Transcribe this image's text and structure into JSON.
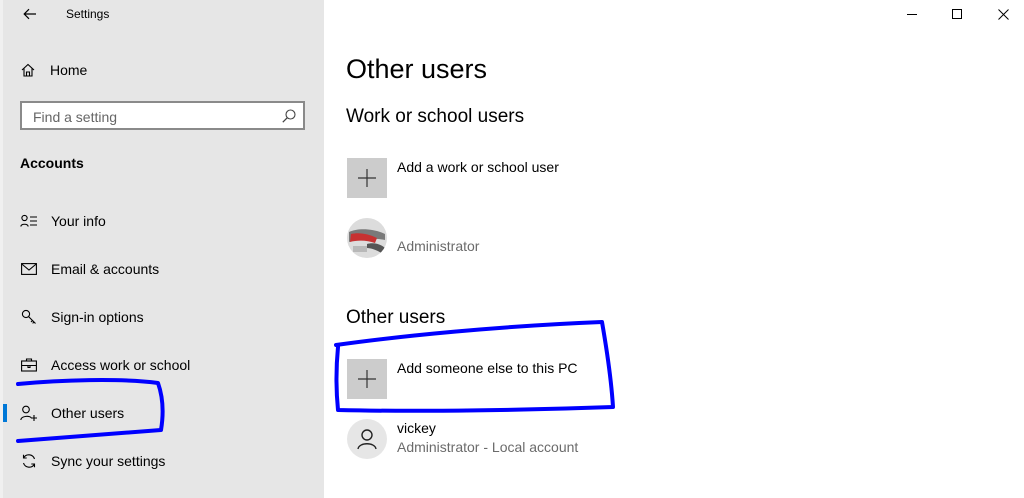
{
  "window": {
    "title": "Settings",
    "controls": [
      "minimize",
      "maximize",
      "close"
    ]
  },
  "sidebar": {
    "home_label": "Home",
    "search": {
      "placeholder": "Find a setting"
    },
    "section_label": "Accounts",
    "items": [
      {
        "label": "Your info",
        "icon": "person-list-icon"
      },
      {
        "label": "Email & accounts",
        "icon": "mail-icon"
      },
      {
        "label": "Sign-in options",
        "icon": "key-icon"
      },
      {
        "label": "Access work or school",
        "icon": "briefcase-icon"
      },
      {
        "label": "Other users",
        "icon": "person-add-icon",
        "selected": true
      },
      {
        "label": "Sync your settings",
        "icon": "sync-icon"
      }
    ]
  },
  "main": {
    "page_title": "Other users",
    "work_section": {
      "title": "Work or school users",
      "add_label": "Add a work or school user",
      "user": {
        "name": "",
        "role": "Administrator"
      }
    },
    "other_section": {
      "title": "Other users",
      "add_label": "Add someone else to this PC",
      "user": {
        "name": "vickey",
        "role": "Administrator - Local account"
      }
    }
  },
  "colors": {
    "sidebar_bg": "#e6e6e6",
    "accent": "#0078d7",
    "annotation": "#0000ff",
    "tile_bg": "#cccccc"
  }
}
